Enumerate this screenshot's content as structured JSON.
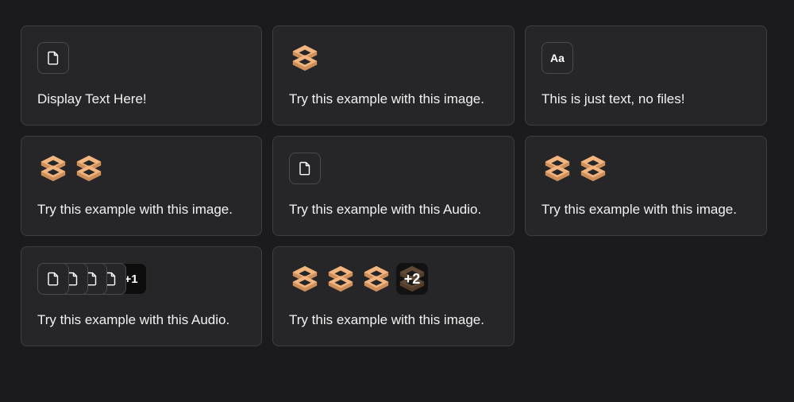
{
  "examples": [
    {
      "label": "Display Text Here!",
      "media": "file"
    },
    {
      "label": "Try this example with this image.",
      "media": "image",
      "count": 1
    },
    {
      "label": "This is just text, no files!",
      "media": "text",
      "badge": "Aa"
    },
    {
      "label": "Try this example with this image.",
      "media": "image",
      "count": 2
    },
    {
      "label": "Try this example with this Audio.",
      "media": "file"
    },
    {
      "label": "Try this example with this image.",
      "media": "image",
      "count": 2
    },
    {
      "label": "Try this example with this Audio.",
      "media": "file",
      "count": 4,
      "more": "+1"
    },
    {
      "label": "Try this example with this image.",
      "media": "image",
      "count": 3,
      "more": "+2"
    }
  ],
  "colors": {
    "background": "#1b1b1d",
    "card": "#262629",
    "border": "#3e3e42",
    "logo_light": "#f3b57f",
    "logo_dark": "#cf8f5b"
  },
  "icons": {
    "file": "file-icon",
    "image": "image-thumbnail-logo"
  }
}
